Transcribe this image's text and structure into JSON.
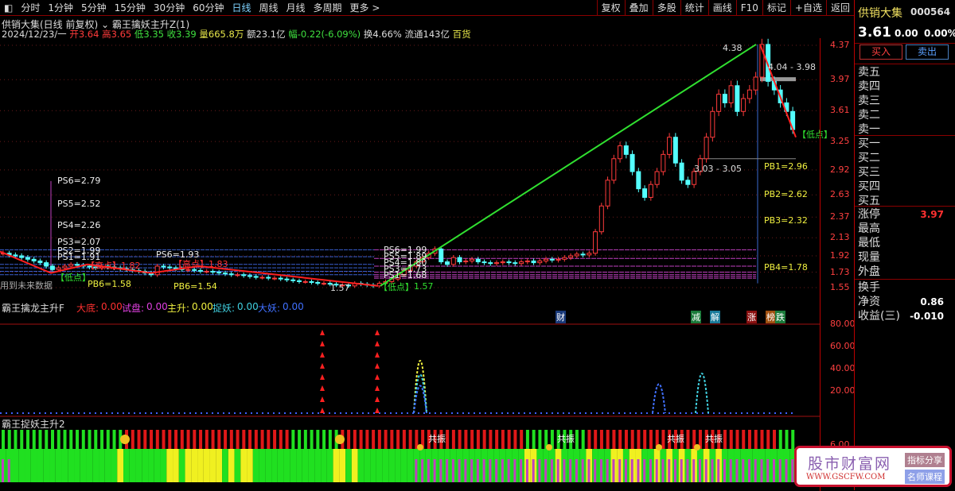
{
  "toolbar": {
    "periods": [
      "分时",
      "1分钟",
      "5分钟",
      "15分钟",
      "30分钟",
      "60分钟",
      "日线",
      "周线",
      "月线",
      "多周期",
      "更多 >"
    ],
    "active": "日线",
    "right_buttons": [
      "复权",
      "叠加",
      "多股",
      "统计",
      "画线",
      "F10",
      "标记",
      "+自选",
      "返回"
    ]
  },
  "header": {
    "title": "供销大集(日线 前复权)",
    "indicator": "霸王擒妖主升Z(1)",
    "date": "2024/12/23/一",
    "open_label": "开",
    "open": "3.64",
    "high_label": "高",
    "high": "3.65",
    "low_label": "低",
    "low": "3.35",
    "close_label": "收",
    "close": "3.39",
    "vol_label": "量",
    "vol": "665.8万",
    "amount": "额23.1亿",
    "chg_label": "幅",
    "chg": "-0.22(-6.09%)",
    "turnover": "换4.66%",
    "float": "流通143亿",
    "sector": "百货"
  },
  "price_axis": [
    "4.37",
    "3.97",
    "3.61",
    "3.25",
    "2.92",
    "2.63",
    "2.37",
    "2.13",
    "1.92",
    "1.73",
    "1.55"
  ],
  "ind_axis": [
    "80.00",
    "60.00",
    "40.00",
    "20.00"
  ],
  "ind2_axis": [
    "6.00"
  ],
  "chart_data": {
    "type": "candlestick",
    "closes": [
      1.95,
      1.93,
      1.92,
      1.9,
      1.88,
      1.86,
      1.84,
      1.8,
      1.76,
      1.78,
      1.8,
      1.82,
      1.81,
      1.8,
      1.79,
      1.78,
      1.8,
      1.79,
      1.78,
      1.77,
      1.76,
      1.75,
      1.74,
      1.72,
      1.7,
      1.8,
      1.79,
      1.78,
      1.77,
      1.76,
      1.76,
      1.75,
      1.74,
      1.74,
      1.73,
      1.72,
      1.71,
      1.7,
      1.7,
      1.69,
      1.68,
      1.67,
      1.67,
      1.66,
      1.66,
      1.65,
      1.64,
      1.63,
      1.62,
      1.62,
      1.61,
      1.6,
      1.6,
      1.59,
      1.58,
      1.58,
      1.57,
      1.6,
      1.59,
      1.58,
      1.57,
      1.6,
      1.62,
      1.65,
      1.7,
      1.75,
      1.8,
      1.85,
      1.9,
      1.95,
      2.0,
      1.85,
      1.82,
      1.9,
      1.85,
      1.86,
      1.88,
      1.85,
      1.84,
      1.83,
      1.84,
      1.85,
      1.84,
      1.83,
      1.85,
      1.86,
      1.84,
      1.86,
      1.88,
      1.87,
      1.88,
      1.9,
      1.92,
      1.94,
      1.93,
      1.95,
      2.2,
      2.5,
      2.8,
      3.05,
      3.2,
      3.1,
      2.9,
      2.7,
      2.6,
      2.75,
      2.9,
      3.1,
      3.3,
      3.0,
      2.8,
      2.75,
      2.9,
      3.05,
      3.3,
      3.6,
      3.8,
      3.7,
      3.9,
      3.6,
      3.75,
      3.85,
      4.0,
      4.38,
      3.95,
      3.85,
      3.7,
      3.6,
      3.39
    ],
    "ylim": [
      1.55,
      4.37
    ]
  },
  "annotations": {
    "ps_left": [
      "PS6=2.79",
      "PS5=2.52",
      "PS4=2.26",
      "PS3=2.07",
      "PS2=1.99",
      "PS1=1.91"
    ],
    "high1": "【高点】1.82",
    "low1": "【低点】",
    "pb_left": "PB6=1.58",
    "ps_mid": [
      "PS6=1.93"
    ],
    "high2": "【高点】1.83",
    "pb_mid": "PB6=1.54",
    "low3_val": "1.57",
    "ps_mid2": [
      "PS6=1.99",
      "PS5=1.89",
      "PS4=1.80",
      "PS3=1.73",
      "PS1=1.68"
    ],
    "low4": "【低点】",
    "low4_val": "1.57",
    "top": "4.38",
    "range1": "4.04 - 3.98",
    "range2": "3.03 - 3.05",
    "pb_right": [
      "PB1=2.96",
      "PB2=2.62",
      "PB3=2.32",
      "PB4=1.78"
    ],
    "low5": "【低点】",
    "future": "用到未来数据",
    "tags": [
      "财",
      "减",
      "解",
      "涨",
      "榜",
      "跌"
    ]
  },
  "ind1": {
    "name": "霸王擒龙主升F",
    "items": [
      {
        "label": "大底:",
        "value": "0.00",
        "color": "#ff3030"
      },
      {
        "label": "试盘:",
        "value": "0.00",
        "color": "#e040e0"
      },
      {
        "label": "主升:",
        "value": "0.00",
        "color": "#f0f040"
      },
      {
        "label": "捉妖:",
        "value": "0.00",
        "color": "#40d0e0"
      },
      {
        "label": "大妖:",
        "value": "0.00",
        "color": "#4070ff"
      }
    ]
  },
  "ind2": {
    "name": "霸王捉妖主升2",
    "resonance": "共振"
  },
  "quote": {
    "name": "供销大集",
    "code": "000564",
    "price": "3.61",
    "chg": "0.00",
    "pct": "0.00%",
    "buy": "买入",
    "sell": "卖出",
    "asks": [
      "卖五",
      "卖四",
      "卖三",
      "卖二",
      "卖一"
    ],
    "bids": [
      "买一",
      "买二",
      "买三",
      "买四",
      "买五"
    ],
    "stats": [
      {
        "label": "涨停",
        "value": "3.97"
      },
      {
        "label": "最高",
        "value": ""
      },
      {
        "label": "最低",
        "value": ""
      },
      {
        "label": "现量",
        "value": ""
      },
      {
        "label": "外盘",
        "value": ""
      }
    ],
    "fin": [
      {
        "label": "换手",
        "value": ""
      },
      {
        "label": "净资",
        "value": "0.86"
      },
      {
        "label": "收益(三)",
        "value": "-0.010"
      }
    ]
  },
  "watermark": {
    "title": "股市财富网",
    "url": "WWW.GSCFW.COM",
    "btn1": "指标分享",
    "btn2": "名师课程"
  }
}
